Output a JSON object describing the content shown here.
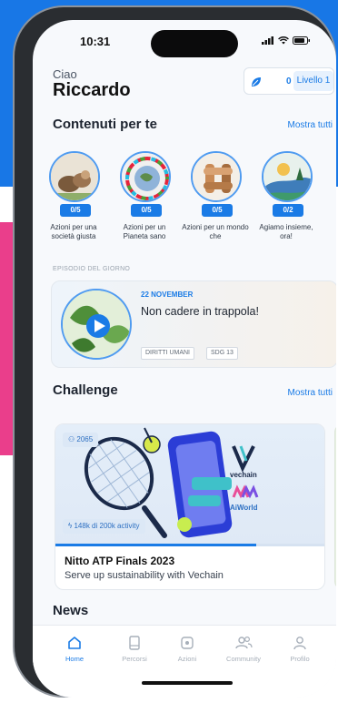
{
  "status_bar": {
    "time": "10:31"
  },
  "header": {
    "greeting": "Ciao",
    "user_name": "Riccardo",
    "points": "0",
    "level": "Livello 1"
  },
  "colors": {
    "accent": "#1a7be6",
    "backdrop_blue": "#1877e6",
    "backdrop_pink": "#ea3e8b"
  },
  "contents": {
    "title": "Contenuti per te",
    "see_all": "Mostra tutti",
    "items": [
      {
        "badge": "0/5",
        "label": "Azioni per una società giusta",
        "icon": "content-icon"
      },
      {
        "badge": "0/5",
        "label": "Azioni per un Pianeta sano",
        "icon": "content-icon"
      },
      {
        "badge": "0/5",
        "label": "Azioni per un mondo che",
        "icon": "content-icon"
      },
      {
        "badge": "0/2",
        "label": "Agiamo insieme, ora!",
        "icon": "content-icon"
      }
    ]
  },
  "episode": {
    "caption": "EPISODIO DEL GIORNO",
    "date": "22 NOVEMBER",
    "title": "Non cadere in trappola!",
    "tags": [
      "DIRITTI UMANI",
      "SDG 13"
    ],
    "play_icon": "play-icon"
  },
  "challenge": {
    "title": "Challenge",
    "see_all": "Mostra tutti",
    "card": {
      "participants": "2065",
      "activity": "148k di 200k activity",
      "progress": 0.74,
      "brand_1": "vechain",
      "brand_2": "AiWorld",
      "name": "Nitto ATP Finals 2023",
      "subtitle": "Serve up sustainability with Vechain"
    }
  },
  "news": {
    "title": "News"
  },
  "tabbar": [
    {
      "label": "Home",
      "icon": "home-icon",
      "active": true
    },
    {
      "label": "Percorsi",
      "icon": "book-icon",
      "active": false
    },
    {
      "label": "Azioni",
      "icon": "actions-icon",
      "active": false
    },
    {
      "label": "Community",
      "icon": "community-icon",
      "active": false
    },
    {
      "label": "Profilo",
      "icon": "profile-icon",
      "active": false
    }
  ]
}
